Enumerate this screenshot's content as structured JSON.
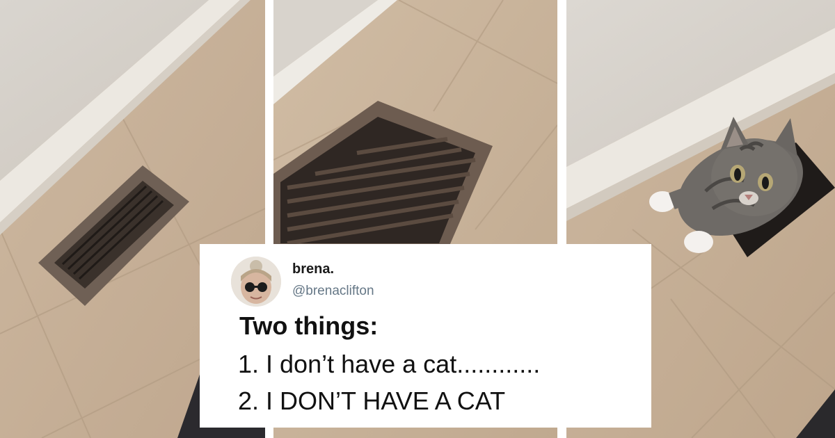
{
  "photos": [
    {
      "subject": "floor-vent-closed"
    },
    {
      "subject": "floor-vent-closeup"
    },
    {
      "subject": "cat-emerging-from-vent"
    }
  ],
  "tweet": {
    "display_name": "brena.",
    "handle": "@brenaclifton",
    "lines": [
      "Two things:",
      "1. I don’t have a cat............",
      "2. I DON’T HAVE A CAT"
    ]
  },
  "colors": {
    "floor_tile": "#c9b49c",
    "wall": "#d8d3cc",
    "baseboard": "#efece6",
    "vent": "#6e5e52",
    "cat_fur": "#6d6a66",
    "card_background": "#ffffff"
  }
}
